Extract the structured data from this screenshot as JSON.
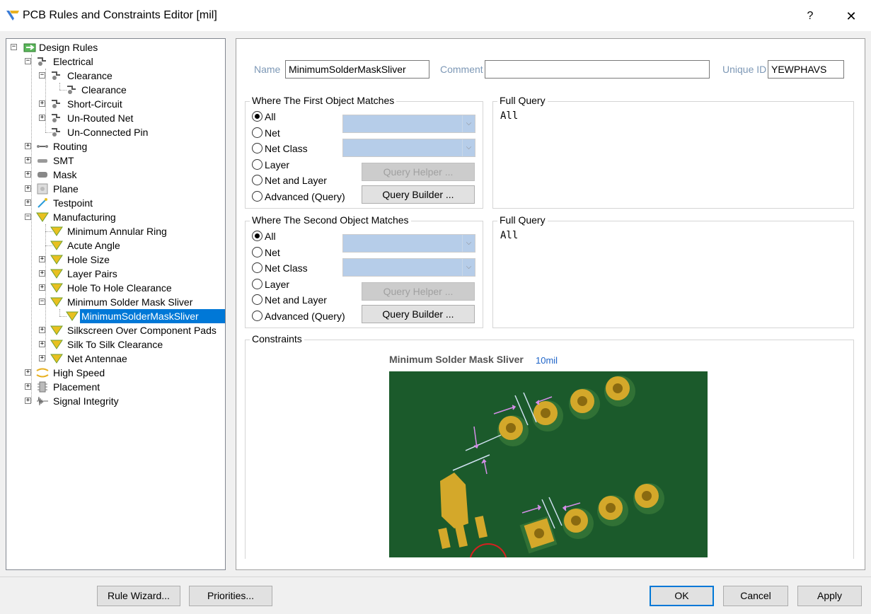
{
  "window": {
    "title": "PCB Rules and Constraints Editor [mil]",
    "help": "?",
    "close": "✕"
  },
  "tree": {
    "root": "Design Rules",
    "electrical": "Electrical",
    "clearance": "Clearance",
    "clearance_rule": "Clearance",
    "short_circuit": "Short-Circuit",
    "unrouted_net": "Un-Routed Net",
    "unconnected_pin": "Un-Connected Pin",
    "routing": "Routing",
    "smt": "SMT",
    "mask": "Mask",
    "plane": "Plane",
    "testpoint": "Testpoint",
    "manufacturing": "Manufacturing",
    "min_annular_ring": "Minimum Annular Ring",
    "acute_angle": "Acute Angle",
    "hole_size": "Hole Size",
    "layer_pairs": "Layer Pairs",
    "hole_to_hole": "Hole To Hole Clearance",
    "min_solder_mask_sliver": "Minimum Solder Mask Sliver",
    "min_solder_mask_sliver_rule": "MinimumSolderMaskSliver",
    "silkscreen_over_pads": "Silkscreen Over Component Pads",
    "silk_to_silk": "Silk To Silk Clearance",
    "net_antennae": "Net Antennae",
    "high_speed": "High Speed",
    "placement": "Placement",
    "signal_integrity": "Signal Integrity"
  },
  "rule": {
    "name_label": "Name",
    "name_value": "MinimumSolderMaskSliver",
    "comment_label": "Comment",
    "comment_value": "",
    "unique_id_label": "Unique ID",
    "unique_id_value": "YEWPHAVS"
  },
  "first_match": {
    "title": "Where The First Object Matches",
    "options": [
      "All",
      "Net",
      "Net Class",
      "Layer",
      "Net and Layer",
      "Advanced (Query)"
    ],
    "selected": "All",
    "query_helper": "Query Helper ...",
    "query_builder": "Query Builder ...",
    "full_query_title": "Full Query",
    "full_query": "All"
  },
  "second_match": {
    "title": "Where The Second Object Matches",
    "options": [
      "All",
      "Net",
      "Net Class",
      "Layer",
      "Net and Layer",
      "Advanced (Query)"
    ],
    "selected": "All",
    "query_helper": "Query Helper ...",
    "query_builder": "Query Builder ...",
    "full_query_title": "Full Query",
    "full_query": "All"
  },
  "constraints": {
    "title": "Constraints",
    "diagram_title": "Minimum Solder Mask Sliver",
    "value": "10mil"
  },
  "buttons": {
    "rule_wizard": "Rule Wizard...",
    "priorities": "Priorities...",
    "ok": "OK",
    "cancel": "Cancel",
    "apply": "Apply"
  },
  "colors": {
    "selection": "#0078d7",
    "pcb_green": "#1b5a2b",
    "pad_gold": "#d4a82a",
    "dimension": "#d48ee8",
    "combo_fill": "#b6cde9"
  }
}
